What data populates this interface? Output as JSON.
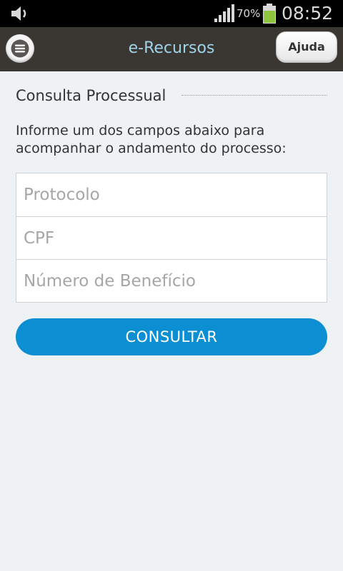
{
  "status_bar": {
    "battery_percent": "70%",
    "time": "08:52",
    "icons": [
      "volume-icon",
      "signal-icon",
      "battery-icon"
    ]
  },
  "app_bar": {
    "title": "e-Recursos",
    "help_label": "Ajuda",
    "menu_icon": "menu-icon"
  },
  "main": {
    "section_title": "Consulta Processual",
    "instructions": "Informe um dos campos abaixo para acompanhar o andamento do processo:",
    "fields": {
      "protocolo": {
        "placeholder": "Protocolo",
        "value": ""
      },
      "cpf": {
        "placeholder": "CPF",
        "value": ""
      },
      "beneficio": {
        "placeholder": "Número de Benefício",
        "value": ""
      }
    },
    "submit_label": "CONSULTAR"
  },
  "colors": {
    "app_bar_bg": "#3a3632",
    "title_color": "#9fd3ea",
    "accent": "#0c8fd2",
    "background": "#eef2f5",
    "battery_green": "#8cc63f"
  }
}
